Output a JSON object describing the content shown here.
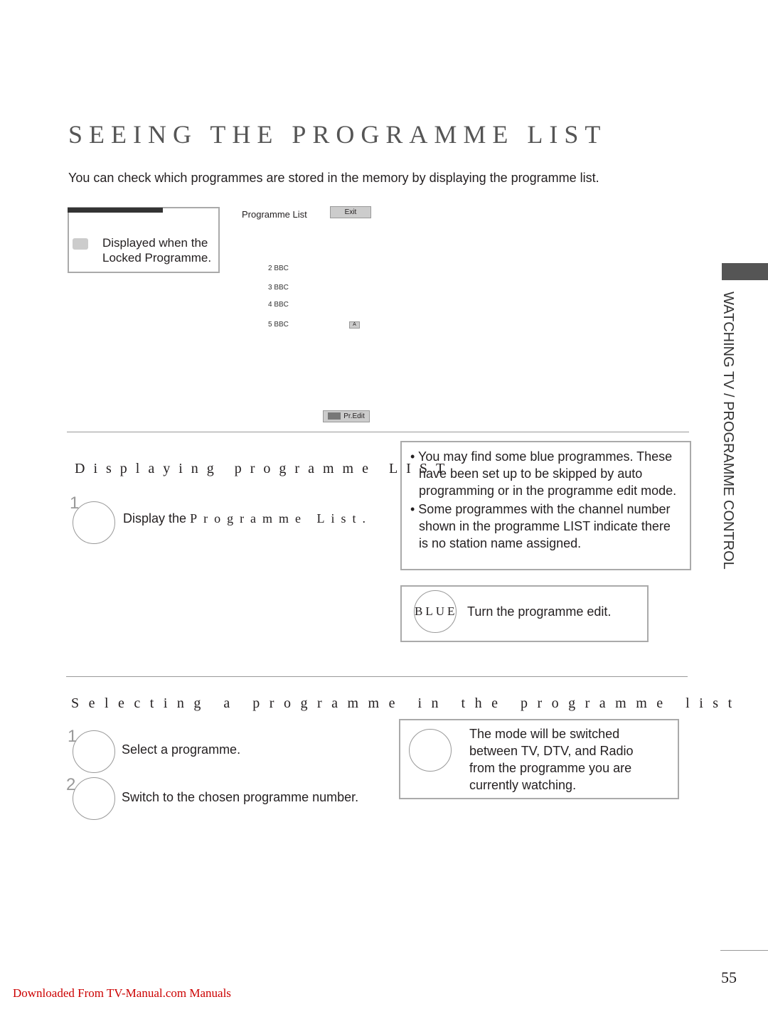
{
  "title": "SEEING THE PROGRAMME LIST",
  "intro": "You can check which programmes are stored in the memory by displaying the programme list.",
  "lock_note": {
    "line1": "Displayed when the",
    "line2": "Locked Programme."
  },
  "programme_list": {
    "heading": "Programme List",
    "exit": "Exit",
    "items": [
      "2 BBC",
      "3 BBC",
      "4 BBC",
      "5 BBC"
    ],
    "badge": "A",
    "pr_edit": "Pr.Edit"
  },
  "section1": {
    "heading": "Displaying programme LIST",
    "step_num": "1",
    "step_prefix": "Display the",
    "step_suffix": "Programme List.",
    "notes": [
      "• You may find some blue programmes. These have been set up to be skipped by auto programming or in the programme edit mode.",
      "• Some programmes with the channel number shown in the programme LIST indicate there is no station name assigned."
    ],
    "blue_label": "BLUE",
    "blue_text": "Turn the programme edit."
  },
  "section2": {
    "heading": "Selecting a programme in the programme list",
    "steps": [
      {
        "num": "1",
        "text": "Select a programme."
      },
      {
        "num": "2",
        "text": "Switch to the chosen programme number."
      }
    ],
    "note": "The mode will be switched between TV, DTV, and Radio from the programme you are currently watching."
  },
  "side_tab": "WATCHING TV / PROGRAMME CONTROL",
  "page_number": "55",
  "footer_link": "Downloaded From TV-Manual.com Manuals"
}
